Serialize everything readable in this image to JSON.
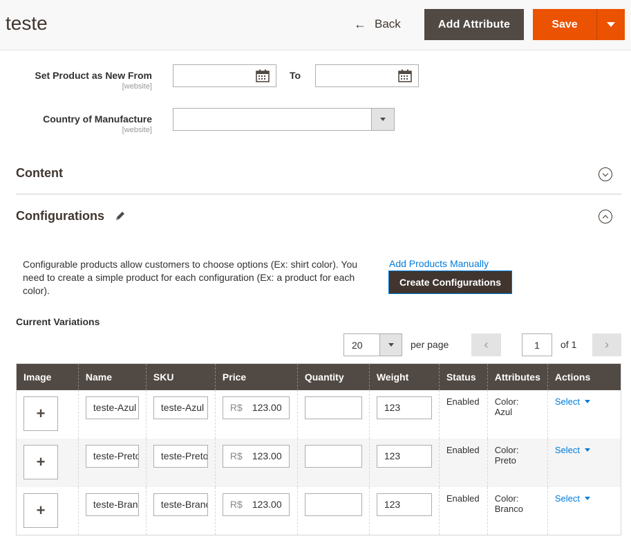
{
  "header": {
    "title": "teste",
    "back_label": "Back",
    "add_attribute_label": "Add Attribute",
    "save_label": "Save"
  },
  "form": {
    "new_from_label": "Set Product as New From",
    "new_from_scope": "[website]",
    "to_label": "To",
    "country_label": "Country of Manufacture",
    "country_scope": "[website]"
  },
  "sections": {
    "content_title": "Content",
    "configurations_title": "Configurations"
  },
  "configurations": {
    "description": "Configurable products allow customers to choose options (Ex: shirt color). You need to create a simple product for each configuration (Ex: a product for each color).",
    "add_manually_label": "Add Products Manually",
    "create_label": "Create Configurations",
    "current_variations_label": "Current Variations"
  },
  "pager": {
    "per_page_value": "20",
    "per_page_label": "per page",
    "current_page": "1",
    "of_label": "of 1"
  },
  "table": {
    "headers": [
      "Image",
      "Name",
      "SKU",
      "Price",
      "Quantity",
      "Weight",
      "Status",
      "Attributes",
      "Actions"
    ],
    "currency_prefix": "R$",
    "rows": [
      {
        "name": "teste-Azul",
        "sku": "teste-Azul",
        "price": "123.00",
        "quantity": "",
        "weight": "123",
        "status": "Enabled",
        "attr_line1": "Color:",
        "attr_line2": "Azul",
        "action": "Select"
      },
      {
        "name": "teste-Preto",
        "sku": "teste-Preto",
        "price": "123.00",
        "quantity": "",
        "weight": "123",
        "status": "Enabled",
        "attr_line1": "Color:",
        "attr_line2": "Preto",
        "action": "Select"
      },
      {
        "name": "teste-Branco",
        "sku": "teste-Branco",
        "price": "123.00",
        "quantity": "",
        "weight": "123",
        "status": "Enabled",
        "attr_line1": "Color:",
        "attr_line2": "Branco",
        "action": "Select"
      }
    ]
  },
  "colors": {
    "primary_dark": "#514943",
    "save_orange": "#eb5202",
    "link_blue": "#007bdb"
  }
}
